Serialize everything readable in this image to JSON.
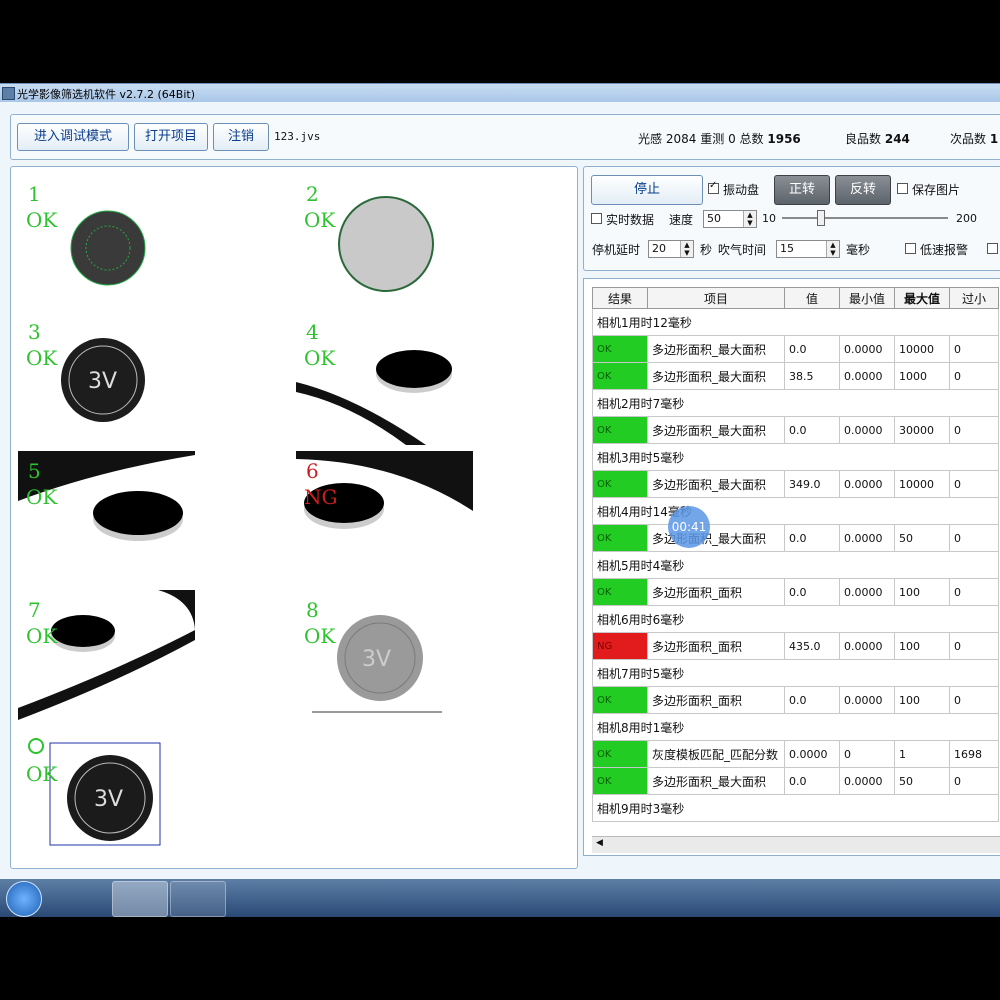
{
  "window": {
    "title": "光学影像筛选机软件 v2.7.2 (64Bit)"
  },
  "toolbar": {
    "debug_button": "进入调试模式",
    "open_button": "打开项目",
    "logout_button": "注销",
    "project_file": "123.jvs"
  },
  "stats": {
    "light_label": "光感",
    "light_value": "2084",
    "retest_label": "重测",
    "retest_value": "0",
    "total_label": "总数",
    "total_value": "1956",
    "good_label": "良品数",
    "good_value": "244",
    "defect_label": "次品数",
    "defect_value": "1"
  },
  "cameras": [
    {
      "num": "1",
      "result": "OK"
    },
    {
      "num": "2",
      "result": "OK"
    },
    {
      "num": "3",
      "result": "OK"
    },
    {
      "num": "4",
      "result": "OK"
    },
    {
      "num": "5",
      "result": "OK"
    },
    {
      "num": "6",
      "result": "NG"
    },
    {
      "num": "7",
      "result": "OK"
    },
    {
      "num": "8",
      "result": "OK"
    },
    {
      "num": "",
      "result": "OK"
    }
  ],
  "controls": {
    "stop_button": "停止",
    "vibrate_label": "振动盘",
    "forward_button": "正转",
    "reverse_button": "反转",
    "save_image_label": "保存图片",
    "realtime_label": "实时数据",
    "speed_label": "速度",
    "speed_value": "50",
    "slider_min": "10",
    "slider_max": "200",
    "slider_level": 0.21,
    "stop_delay_label": "停机延时",
    "stop_delay_value": "20",
    "sec_label": "秒",
    "blow_label": "吹气时间",
    "blow_value": "15",
    "ms_label": "毫秒",
    "low_speed_label": "低速报警"
  },
  "table": {
    "headers": [
      "结果",
      "项目",
      "值",
      "最小值",
      "最大值",
      "过小"
    ],
    "rows": [
      {
        "group": "相机1用时12毫秒"
      },
      {
        "result": "OK",
        "item": "多边形面积_最大面积",
        "value": "0.0",
        "min": "0.0000",
        "max": "10000",
        "low": "0"
      },
      {
        "result": "OK",
        "item": "多边形面积_最大面积",
        "value": "38.5",
        "min": "0.0000",
        "max": "1000",
        "low": "0"
      },
      {
        "group": "相机2用时7毫秒"
      },
      {
        "result": "OK",
        "item": "多边形面积_最大面积",
        "value": "0.0",
        "min": "0.0000",
        "max": "30000",
        "low": "0"
      },
      {
        "group": "相机3用时5毫秒"
      },
      {
        "result": "OK",
        "item": "多边形面积_最大面积",
        "value": "349.0",
        "min": "0.0000",
        "max": "10000",
        "low": "0"
      },
      {
        "group": "相机4用时14毫秒"
      },
      {
        "result": "OK",
        "item": "多边形面积_最大面积",
        "value": "0.0",
        "min": "0.0000",
        "max": "50",
        "low": "0"
      },
      {
        "group": "相机5用时4毫秒"
      },
      {
        "result": "OK",
        "item": "多边形面积_面积",
        "value": "0.0",
        "min": "0.0000",
        "max": "100",
        "low": "0"
      },
      {
        "group": "相机6用时6毫秒"
      },
      {
        "result": "NG",
        "item": "多边形面积_面积",
        "value": "435.0",
        "min": "0.0000",
        "max": "100",
        "low": "0"
      },
      {
        "group": "相机7用时5毫秒"
      },
      {
        "result": "OK",
        "item": "多边形面积_面积",
        "value": "0.0",
        "min": "0.0000",
        "max": "100",
        "low": "0"
      },
      {
        "group": "相机8用时1毫秒"
      },
      {
        "result": "OK",
        "item": "灰度模板匹配_匹配分数",
        "value": "0.0000",
        "min": "0",
        "max": "1",
        "low": "1698"
      },
      {
        "result": "OK",
        "item": "多边形面积_最大面积",
        "value": "0.0",
        "min": "0.0000",
        "max": "50",
        "low": "0"
      },
      {
        "group": "相机9用时3毫秒"
      }
    ]
  },
  "overlay": {
    "timer": "00:41"
  },
  "colors": {
    "ok_green": "#22cc22",
    "ng_red": "#e21c1c",
    "accent_blue": "#0a3d8f"
  }
}
